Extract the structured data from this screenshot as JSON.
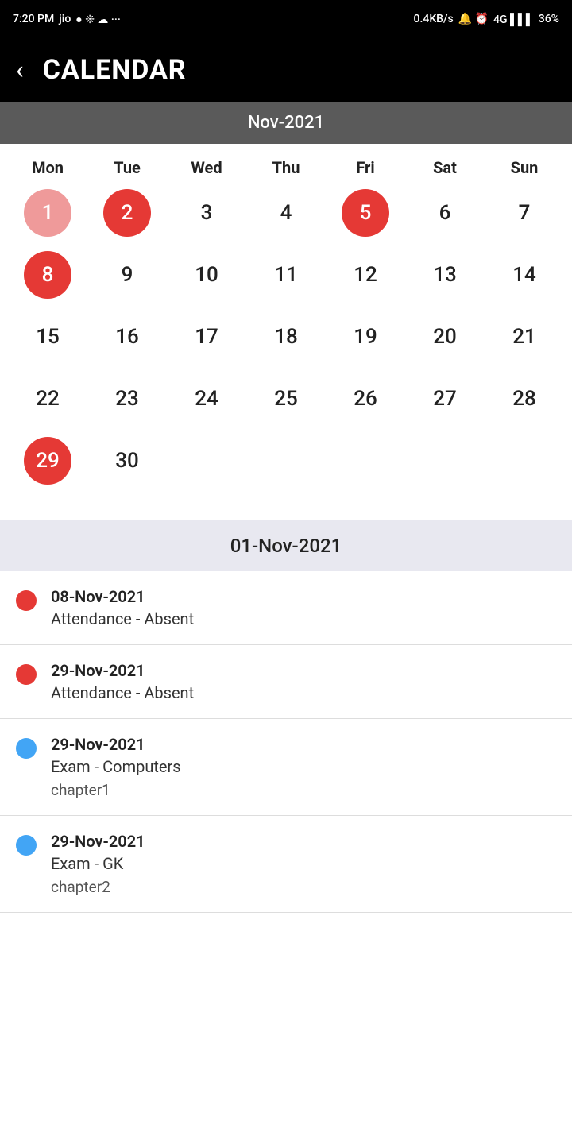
{
  "statusBar": {
    "time": "7:20 PM",
    "network": "0.4KB/s",
    "battery": "36%"
  },
  "appBar": {
    "title": "CALENDAR",
    "backLabel": "‹"
  },
  "calendar": {
    "monthLabel": "Nov-2021",
    "dayHeaders": [
      "Mon",
      "Tue",
      "Wed",
      "Thu",
      "Fri",
      "Sat",
      "Sun"
    ],
    "weeks": [
      [
        {
          "day": "1",
          "style": "circle-red-light"
        },
        {
          "day": "2",
          "style": "circle-red"
        },
        {
          "day": "3",
          "style": ""
        },
        {
          "day": "4",
          "style": ""
        },
        {
          "day": "5",
          "style": "circle-red"
        },
        {
          "day": "6",
          "style": ""
        },
        {
          "day": "7",
          "style": ""
        }
      ],
      [
        {
          "day": "8",
          "style": "circle-red"
        },
        {
          "day": "9",
          "style": ""
        },
        {
          "day": "10",
          "style": ""
        },
        {
          "day": "11",
          "style": ""
        },
        {
          "day": "12",
          "style": ""
        },
        {
          "day": "13",
          "style": ""
        },
        {
          "day": "14",
          "style": ""
        }
      ],
      [
        {
          "day": "15",
          "style": ""
        },
        {
          "day": "16",
          "style": ""
        },
        {
          "day": "17",
          "style": ""
        },
        {
          "day": "18",
          "style": ""
        },
        {
          "day": "19",
          "style": ""
        },
        {
          "day": "20",
          "style": ""
        },
        {
          "day": "21",
          "style": ""
        }
      ],
      [
        {
          "day": "22",
          "style": ""
        },
        {
          "day": "23",
          "style": ""
        },
        {
          "day": "24",
          "style": ""
        },
        {
          "day": "25",
          "style": ""
        },
        {
          "day": "26",
          "style": ""
        },
        {
          "day": "27",
          "style": ""
        },
        {
          "day": "28",
          "style": ""
        }
      ],
      [
        {
          "day": "29",
          "style": "circle-red"
        },
        {
          "day": "30",
          "style": ""
        },
        {
          "day": "",
          "style": "empty"
        },
        {
          "day": "",
          "style": "empty"
        },
        {
          "day": "",
          "style": "empty"
        },
        {
          "day": "",
          "style": "empty"
        },
        {
          "day": "",
          "style": "empty"
        }
      ]
    ]
  },
  "eventSection": {
    "selectedDate": "01-Nov-2021",
    "events": [
      {
        "dotColor": "red",
        "date": "08-Nov-2021",
        "title": "Attendance - Absent",
        "subtitle": ""
      },
      {
        "dotColor": "red",
        "date": "29-Nov-2021",
        "title": "Attendance - Absent",
        "subtitle": ""
      },
      {
        "dotColor": "blue",
        "date": "29-Nov-2021",
        "title": "Exam - Computers",
        "subtitle": "chapter1"
      },
      {
        "dotColor": "blue",
        "date": "29-Nov-2021",
        "title": "Exam - GK",
        "subtitle": "chapter2"
      }
    ]
  }
}
